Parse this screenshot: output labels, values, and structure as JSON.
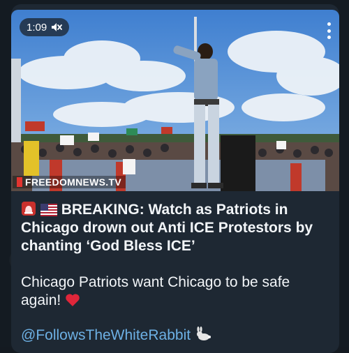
{
  "video": {
    "time": "1:09",
    "watermark": "FREEDOMNEWS.TV",
    "mute_icon": "speaker-muted-icon",
    "menu_icon": "more-vertical-icon"
  },
  "message": {
    "headline": "BREAKING: Watch as Patriots in Chicago drown out Anti ICE Protestors by chanting ‘God Bless ICE’",
    "body": "Chicago Patriots want Chicago to be safe again!",
    "handle": "@FollowsTheWhiteRabbit"
  },
  "colors": {
    "background": "#141b22",
    "bubble": "#1e2833",
    "link": "#6db0e4",
    "text": "#f2f5f8"
  }
}
